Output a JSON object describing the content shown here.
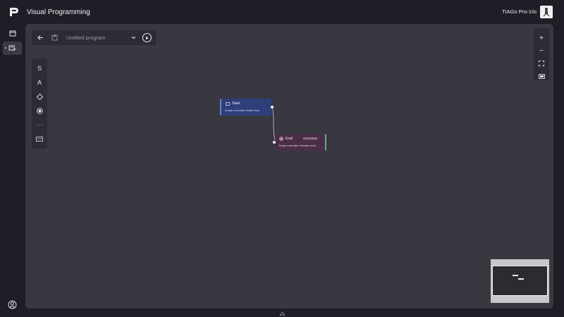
{
  "header": {
    "app_title": "Visual Programming",
    "robot_name": "TIAGo Pro-10c"
  },
  "toolbar": {
    "program_name": "Untitled program"
  },
  "palette": {
    "items": [
      "S",
      "A"
    ]
  },
  "zoom": {
    "zoom_in": "+",
    "zoom_out": "−"
  },
  "nodes": {
    "start": {
      "title": "Start",
      "description": "Graph execution starts here"
    },
    "end": {
      "title": "End",
      "status": "success",
      "description": "Graph execution finishes here"
    }
  },
  "colors": {
    "start_node": "#2e3f7a",
    "end_node": "#4a2e47",
    "canvas": "#383840",
    "background": "#1e1e26"
  }
}
